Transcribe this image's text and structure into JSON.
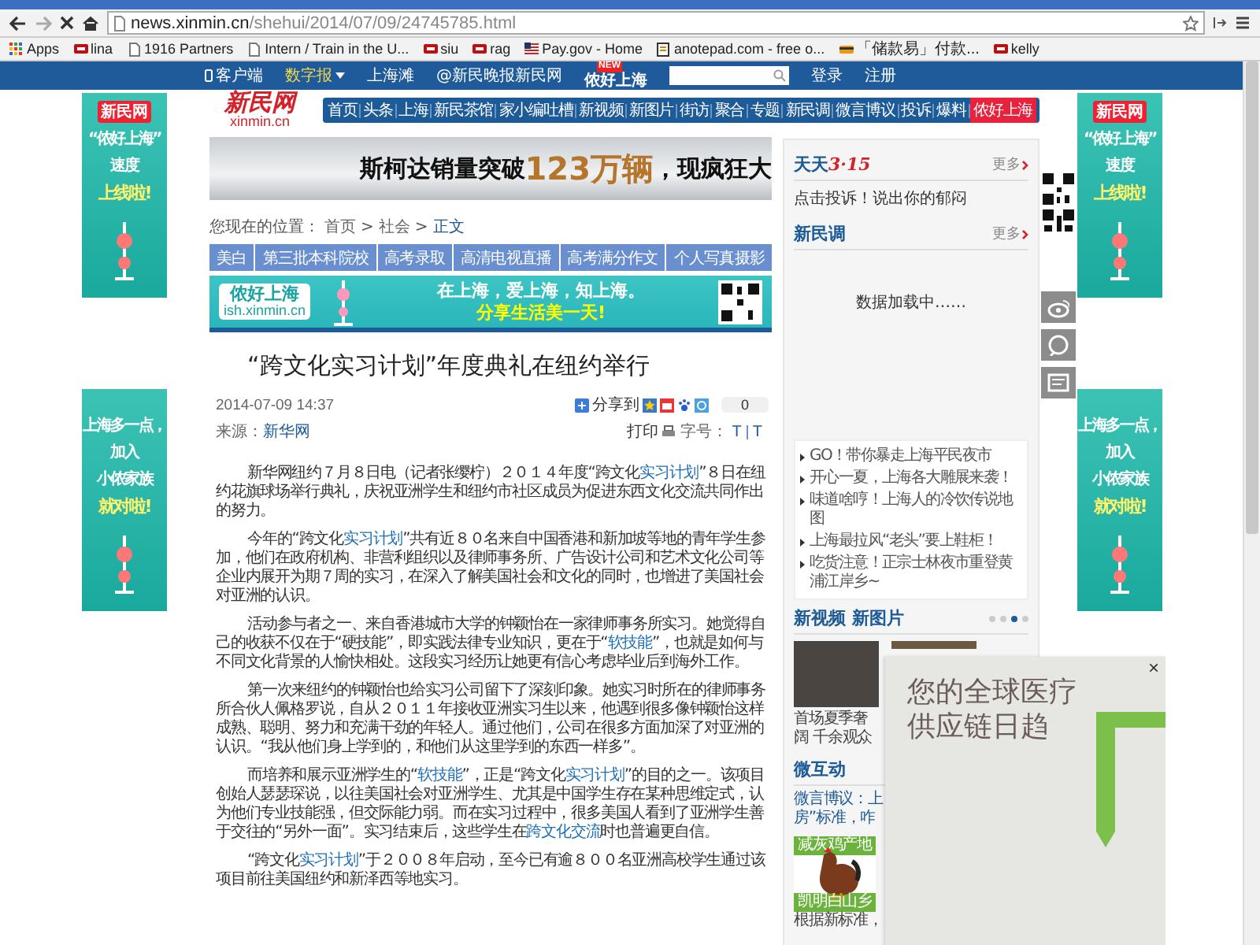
{
  "browser": {
    "url_host": "news.xinmin.cn",
    "url_path": "/shehui/2014/07/09/24745785.html",
    "bookmarks": [
      {
        "label": "Apps",
        "kind": "apps"
      },
      {
        "label": "lina",
        "kind": "site"
      },
      {
        "label": "1916 Partners",
        "kind": "page"
      },
      {
        "label": "Intern / Train in the U...",
        "kind": "page"
      },
      {
        "label": "siu",
        "kind": "site"
      },
      {
        "label": "rag",
        "kind": "site"
      },
      {
        "label": "Pay.gov - Home",
        "kind": "flag"
      },
      {
        "label": "anotepad.com - free o...",
        "kind": "note"
      },
      {
        "label": "「储款易」付款...",
        "kind": "card"
      },
      {
        "label": "kelly",
        "kind": "site"
      }
    ]
  },
  "topbar": {
    "links": [
      {
        "label": "客户端",
        "kind": "app"
      },
      {
        "label": "数字报",
        "kind": "menu"
      },
      {
        "label": "上海滩",
        "kind": "plain"
      },
      {
        "label": "@新民晚报新民网",
        "kind": "plain"
      },
      {
        "label": "侬好上海",
        "kind": "new",
        "badge": "NEW"
      }
    ],
    "login": "登录",
    "register": "注册"
  },
  "side_ads": {
    "left": [
      {
        "logo": "新民网",
        "lines": [
          "“侬好上海”",
          "速度",
          "上线啦!"
        ]
      },
      {
        "lines": [
          "上海多一点，",
          "加入",
          "小侬家族",
          "就对啦!"
        ]
      }
    ],
    "right": [
      {
        "logo": "新民网",
        "lines": [
          "“侬好上海”",
          "速度",
          "上线啦!"
        ]
      },
      {
        "lines": [
          "上海多一点，",
          "加入",
          "小侬家族",
          "就对啦!"
        ]
      }
    ]
  },
  "header": {
    "logo": "新民网",
    "logo_domain": "xinmin.cn",
    "nav": [
      {
        "label": "首页",
        "kind": "link"
      },
      {
        "label": "头条",
        "kind": "link"
      },
      {
        "label": "上海",
        "kind": "link"
      },
      {
        "label": "新民茶馆",
        "kind": "link"
      },
      {
        "label": "家小编吐槽",
        "kind": "link"
      },
      {
        "label": "新视频",
        "kind": "link"
      },
      {
        "label": "新图片",
        "kind": "link"
      },
      {
        "label": "街访",
        "kind": "link"
      },
      {
        "label": "聚合",
        "kind": "link"
      },
      {
        "label": "专题",
        "kind": "link"
      },
      {
        "label": "新民调",
        "kind": "link"
      },
      {
        "label": "微言博议",
        "kind": "link"
      },
      {
        "label": "投诉",
        "kind": "link"
      },
      {
        "label": "爆料",
        "kind": "link"
      },
      {
        "label": "侬好上海",
        "kind": "highlight"
      }
    ]
  },
  "banner": {
    "text": "斯柯达销量突破",
    "number": "123万辆",
    "tail": "，现疯狂大"
  },
  "breadcrumb": {
    "prefix": "您现在的位置：",
    "separator": ">",
    "items": [
      "首页",
      "社会",
      "正文"
    ]
  },
  "topic_tabs": [
    "美白",
    "第三批本科院校",
    "高考录取",
    "高清电视直播",
    "高考满分作文",
    "个人写真摄影"
  ],
  "promo": {
    "brand": "侬好上海",
    "domain": "ish.xinmin.cn",
    "slogan": "在上海，爱上海，知上海。",
    "tagline": "分享生活美一天!"
  },
  "article": {
    "title": "“跨文化实习计划”年度典礼在纽约举行",
    "date": "2014-07-09 14:37",
    "source_label": "来源：",
    "source": "新华网",
    "share_label": "分享到",
    "share_count": "0",
    "print": "打印",
    "font_label": "字号：",
    "font_sizes": [
      "T",
      "T"
    ],
    "paragraphs": [
      [
        {
          "kind": "text",
          "text": "新华网纽约７月８日电（记者张缨柠）２０１４年度“跨文化"
        },
        {
          "kind": "link",
          "text": "实习计划"
        },
        {
          "kind": "text",
          "text": "”８日在纽约花旗球场举行典礼，庆祝亚洲学生和纽约市社区成员为促进东西文化交流共同作出的努力。"
        }
      ],
      [
        {
          "kind": "text",
          "text": "今年的“跨文化"
        },
        {
          "kind": "link",
          "text": "实习计划"
        },
        {
          "kind": "text",
          "text": "”共有近８０名来自中国香港和新加坡等地的青年学生参加，他们在政府机构、非营利组织以及律师事务所、广告设计公司和艺术文化公司等企业内展开为期７周的实习，在深入了解美国社会和文化的同时，也增进了美国社会对亚洲的认识。"
        }
      ],
      [
        {
          "kind": "text",
          "text": "活动参与者之一、来自香港城市大学的钟颖怡在一家律师事务所实习。她觉得自己的收获不仅在于“硬技能”，即实践法律专业知识，更在于“"
        },
        {
          "kind": "link",
          "text": "软技能"
        },
        {
          "kind": "text",
          "text": "”，也就是如何与不同文化背景的人愉快相处。这段实习经历让她更有信心考虑毕业后到海外工作。"
        }
      ],
      [
        {
          "kind": "text",
          "text": "第一次来纽约的钟颖怡也给实习公司留下了深刻印象。她实习时所在的律师事务所合伙人佩格罗说，自从２０１１年接收亚洲实习生以来，他遇到很多像钟颖怡这样成熟、聪明、努力和充满干劲的年轻人。通过他们，公司在很多方面加深了对亚洲的认识。“我从他们身上学到的，和他们从这里学到的东西一样多”。"
        }
      ],
      [
        {
          "kind": "text",
          "text": "而培养和展示亚洲学生的“"
        },
        {
          "kind": "link",
          "text": "软技能"
        },
        {
          "kind": "text",
          "text": "”，正是“跨文化"
        },
        {
          "kind": "link",
          "text": "实习计划"
        },
        {
          "kind": "text",
          "text": "”的目的之一。该项目创始人瑟瑟琛说，以往美国社会对亚洲学生、尤其是中国学生存在某种思维定式，认为他们专业技能强，但交际能力弱。而在实习过程中，很多美国人看到了亚洲学生善于交往的“另外一面”。实习结束后，这些学生在"
        },
        {
          "kind": "link",
          "text": "跨文化交流"
        },
        {
          "kind": "text",
          "text": "时也普遍更自信。"
        }
      ],
      [
        {
          "kind": "text",
          "text": "“跨文化"
        },
        {
          "kind": "link",
          "text": "实习计划"
        },
        {
          "kind": "text",
          "text": "”于２００８年启动，至今已有逾８００名亚洲高校学生通过该项目前往美国纽约和新泽西等地实习。"
        }
      ]
    ]
  },
  "sidebar": {
    "complaints": {
      "title": "天天",
      "mark": "3·15",
      "more": "更多",
      "text": "点击投诉！说出你的郁闷"
    },
    "poll": {
      "title": "新民调",
      "more": "更多",
      "loading": "数据加载中……"
    },
    "list": [
      "GO！带你暴走上海平民夜市",
      "开心一夏，上海各大雕展来袭！",
      "味道啥哼！上海人的冷饮传说地图",
      "上海最拉风“老头”要上鞋柜！",
      "吃货注意！正宗士林夜市重登黄浦江岸乡~"
    ],
    "media": {
      "title": "新视频 新图片",
      "dots": [
        {
          "selected": false
        },
        {
          "selected": false
        },
        {
          "selected": true
        },
        {
          "selected": false
        }
      ],
      "caption": [
        "首场夏季奢",
        "阔 千余观众"
      ]
    },
    "interact": {
      "title": "微互动",
      "lines": [
        "微言博议：上",
        "房”标准，咋"
      ]
    },
    "product": {
      "header": "减灰鸡产地",
      "footer": "凯明白山乡",
      "lines": [
        "根据新标准，"
      ]
    }
  },
  "popup_ad": {
    "lines": [
      "您的全球医疗",
      "供应链日趋"
    ],
    "close": "×"
  }
}
